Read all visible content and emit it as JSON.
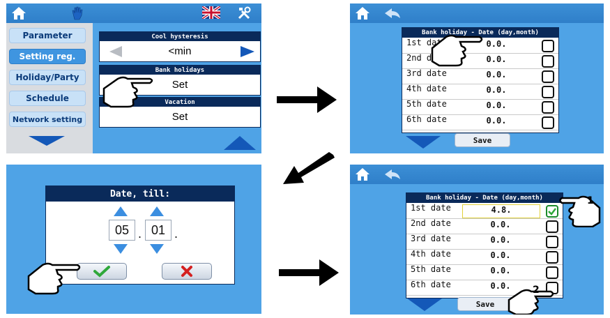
{
  "panel1": {
    "menu": [
      "Parameter",
      "Setting reg.",
      "Holiday/Party",
      "Schedule",
      "Network setting"
    ],
    "active_index": 1,
    "cards": [
      {
        "title": "Cool hysteresis",
        "value": "<min"
      },
      {
        "title": "Bank holidays",
        "value": "Set"
      },
      {
        "title": "Vacation",
        "value": "Set"
      }
    ]
  },
  "panel2": {
    "title": "Bank holiday - Date (day,month)",
    "rows": [
      {
        "label": "1st date",
        "value": "0.0."
      },
      {
        "label": "2nd date",
        "value": "0.0."
      },
      {
        "label": "3rd date",
        "value": "0.0."
      },
      {
        "label": "4th date",
        "value": "0.0."
      },
      {
        "label": "5th date",
        "value": "0.0."
      },
      {
        "label": "6th date",
        "value": "0.0."
      }
    ],
    "save_label": "Save"
  },
  "panel3": {
    "title": "Date, till:",
    "day": "05",
    "month": "01",
    "separator": "."
  },
  "panel4": {
    "title": "Bank holiday - Date (day,month)",
    "rows": [
      {
        "label": "1st date",
        "value": "4.8.",
        "checked": true
      },
      {
        "label": "2nd date",
        "value": "0.0.",
        "checked": false
      },
      {
        "label": "3rd date",
        "value": "0.0.",
        "checked": false
      },
      {
        "label": "4th date",
        "value": "0.0.",
        "checked": false
      },
      {
        "label": "5th date",
        "value": "0.0.",
        "checked": false
      },
      {
        "label": "6th date",
        "value": "0.0.",
        "checked": false
      }
    ],
    "save_label": "Save",
    "callouts": [
      "1",
      "2"
    ]
  },
  "colors": {
    "screen_bg": "#4fa3e6",
    "header_navy": "#0a2a5a",
    "check_green": "#1b8a2b",
    "cancel_red": "#d42020"
  },
  "icons": [
    "home-icon",
    "hand-icon",
    "uk-flag-icon",
    "tools-icon",
    "back-arrow-icon",
    "pointing-hand-icon",
    "down-arrow-icon",
    "up-arrow-icon",
    "checkmark-icon",
    "cross-icon",
    "flow-arrow-icon"
  ]
}
